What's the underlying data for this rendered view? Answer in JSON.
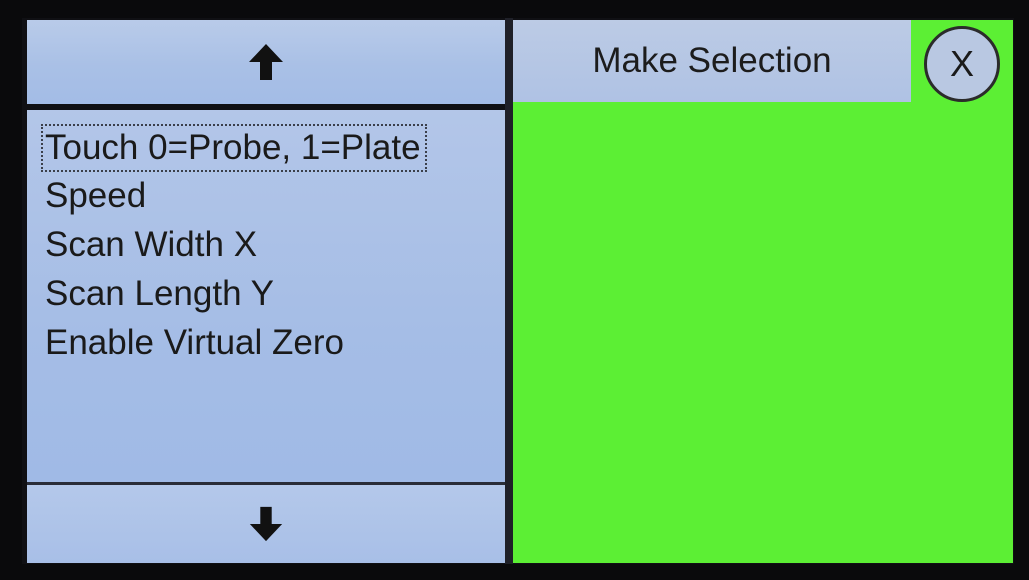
{
  "header": {
    "make_selection_label": "Make Selection",
    "close_label": "X"
  },
  "navigation": {
    "up_icon": "arrow-up-icon",
    "down_icon": "arrow-down-icon"
  },
  "menu": {
    "items": [
      {
        "label": "Touch 0=Probe, 1=Plate",
        "selected": true
      },
      {
        "label": "Speed",
        "selected": false
      },
      {
        "label": "Scan Width X",
        "selected": false
      },
      {
        "label": "Scan Length Y",
        "selected": false
      },
      {
        "label": "Enable Virtual Zero",
        "selected": false
      }
    ]
  },
  "colors": {
    "panel_blue": "#a9c0e6",
    "status_green": "#5cef34",
    "background": "#0a0a0c"
  }
}
